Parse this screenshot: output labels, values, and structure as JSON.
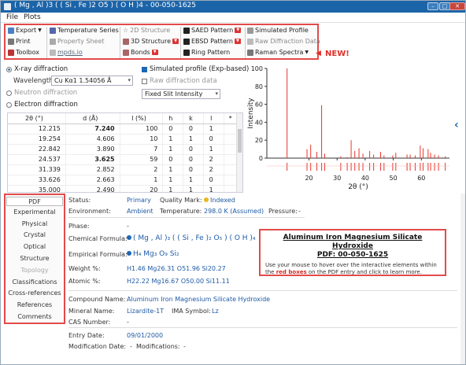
{
  "window": {
    "title": "( Mg , Al )3 ( ( Si , Fe )2 O5 ) ( O H )4 - 00-050-1625",
    "btns": [
      "–",
      "□",
      "✕"
    ]
  },
  "menu": [
    "File",
    "Plots"
  ],
  "toolbar": {
    "export": "Export",
    "print": "Print",
    "toolbox": "Toolbox",
    "temp_series": "Temperature Series",
    "property_sheet": "Property Sheet",
    "mpds": "mpds.io",
    "structure_2d": "2D Structure",
    "structure_3d": "3D Structure",
    "bonds": "Bonds",
    "saed": "SAED Pattern",
    "ebsd": "EBSD Pattern",
    "ring": "Ring Pattern",
    "sim_profile": "Simulated Profile",
    "raw_diff": "Raw Diffraction Data",
    "raman": "Raman Spectra"
  },
  "new_label": "NEW!",
  "options": {
    "xray": "X-ray diffraction",
    "wavelength_label": "Wavelength:",
    "wavelength_value": "Cu Kα1 1.54056 Å",
    "neutron": "Neutron diffraction",
    "electron": "Electron diffraction",
    "sim_profile_chk": "Simulated profile (Exp-based)",
    "raw_chk": "Raw diffraction data",
    "intensity_sel": "Fixed Slit Intensity"
  },
  "table": {
    "headers": [
      "2θ (°)",
      "d (Å)",
      "I (%)",
      "h",
      "k",
      "l",
      "*"
    ],
    "rows": [
      [
        "12.215",
        "7.240",
        "100",
        "0",
        "0",
        "1",
        ""
      ],
      [
        "19.254",
        "4.606",
        "10",
        "1",
        "1",
        "0",
        ""
      ],
      [
        "22.842",
        "3.890",
        "7",
        "1",
        "0",
        "1",
        ""
      ],
      [
        "24.537",
        "3.625",
        "59",
        "0",
        "0",
        "2",
        ""
      ],
      [
        "31.339",
        "2.852",
        "2",
        "1",
        "0",
        "2",
        ""
      ],
      [
        "33.626",
        "2.663",
        "1",
        "1",
        "1",
        "0",
        ""
      ],
      [
        "35.000",
        "2.490",
        "20",
        "1",
        "1",
        "1",
        ""
      ]
    ]
  },
  "chart_data": {
    "type": "bar",
    "xlabel": "2θ (°)",
    "ylabel": "Intensity",
    "xlim": [
      5,
      70
    ],
    "ylim": [
      0,
      100
    ],
    "x_ticks": [
      20,
      30,
      40,
      50,
      60
    ],
    "y_ticks": [
      0,
      20,
      40,
      60,
      80,
      100
    ],
    "peaks": [
      {
        "x": 12.2,
        "y": 100
      },
      {
        "x": 19.3,
        "y": 10
      },
      {
        "x": 20.6,
        "y": 15
      },
      {
        "x": 22.8,
        "y": 7
      },
      {
        "x": 24.5,
        "y": 59
      },
      {
        "x": 25.6,
        "y": 5
      },
      {
        "x": 31.3,
        "y": 2
      },
      {
        "x": 33.6,
        "y": 1
      },
      {
        "x": 35.0,
        "y": 20
      },
      {
        "x": 36.3,
        "y": 8
      },
      {
        "x": 37.8,
        "y": 11
      },
      {
        "x": 39.2,
        "y": 5
      },
      {
        "x": 41.6,
        "y": 8
      },
      {
        "x": 43.0,
        "y": 4
      },
      {
        "x": 45.5,
        "y": 7
      },
      {
        "x": 46.7,
        "y": 3
      },
      {
        "x": 49.8,
        "y": 3
      },
      {
        "x": 50.9,
        "y": 6
      },
      {
        "x": 54.9,
        "y": 4
      },
      {
        "x": 56.0,
        "y": 4
      },
      {
        "x": 57.8,
        "y": 3
      },
      {
        "x": 59.6,
        "y": 14
      },
      {
        "x": 60.6,
        "y": 11
      },
      {
        "x": 62.4,
        "y": 10
      },
      {
        "x": 63.3,
        "y": 6
      },
      {
        "x": 64.7,
        "y": 4
      },
      {
        "x": 66.1,
        "y": 3
      },
      {
        "x": 68.5,
        "y": 2
      }
    ],
    "color": "#e8332a"
  },
  "sidebar": [
    "PDF",
    "Experimental",
    "Physical",
    "Crystal",
    "Optical",
    "Structure",
    "Topology",
    "Classifications",
    "Cross-references",
    "References",
    "Comments"
  ],
  "details": {
    "status_lbl": "Status:",
    "status": "Primary",
    "quality_lbl": "Quality Mark:",
    "quality": "Indexed",
    "env_lbl": "Environment:",
    "env": "Ambient",
    "temp_lbl": "Temperature:",
    "temp": "298.0 K (Assumed)",
    "press_lbl": "Pressure:",
    "press": "-",
    "phase_lbl": "Phase:",
    "phase": "-",
    "chem_lbl": "Chemical Formula:",
    "chem": "( Mg , Al )₃ ( ( Si , Fe )₂ O₅ ) ( O H )₄",
    "emp_lbl": "Empirical Formula:",
    "emp": "H₄ Mg₃ O₉ Si₂",
    "wt_lbl": "Weight %:",
    "wt": "H1.46 Mg26.31 O51.96 Si20.27",
    "at_lbl": "Atomic %:",
    "at": "H22.22 Mg16.67 O50.00 Si11.11",
    "cmp_lbl": "Compound Name:",
    "cmp": "Aluminum Iron Magnesium Silicate Hydroxide",
    "min_lbl": "Mineral Name:",
    "min": "Lizardite-1T",
    "ima_lbl": "IMA Symbol:",
    "ima": "Lz",
    "cas_lbl": "CAS Number:",
    "cas": "-",
    "entry_lbl": "Entry Date:",
    "entry": "09/01/2000",
    "mod_lbl": "Modification Date:",
    "mod": "-",
    "mods_lbl": "Modifications:",
    "mods": "-"
  },
  "callout": {
    "title1": "Aluminum Iron Magnesium Silicate Hydroxide",
    "title2": "PDF: 00-050-1625",
    "body1": "Use your mouse to hover over the interactive elements within the",
    "body_red": "red boxes",
    "body2": "on the PDF entry and click to learn more."
  }
}
